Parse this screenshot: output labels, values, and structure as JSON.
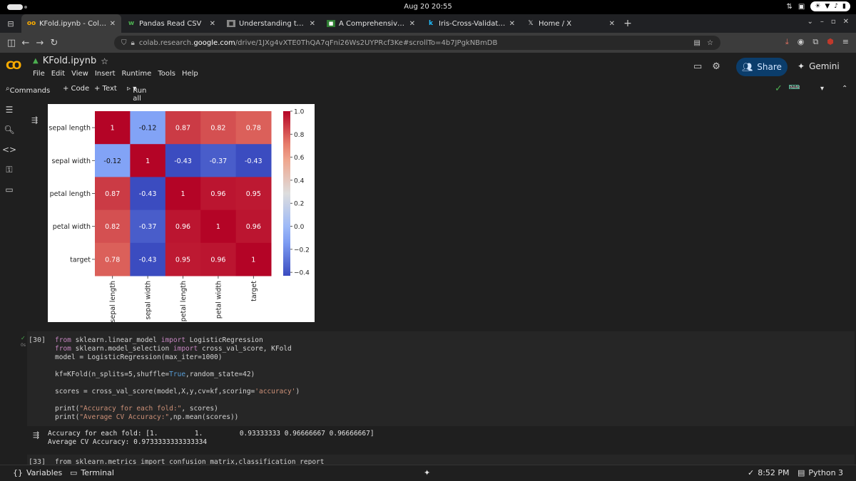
{
  "os": {
    "clock": "Aug 20  20:55"
  },
  "tabs": [
    {
      "title": "KFold.ipynb - Colab",
      "icon": "colab-icon",
      "active": true
    },
    {
      "title": "Pandas Read CSV",
      "icon": "w3schools-icon"
    },
    {
      "title": "Understanding the Confu",
      "icon": "site-icon"
    },
    {
      "title": "A Comprehensive Guide t",
      "icon": "site-icon"
    },
    {
      "title": "Iris-Cross-Validation",
      "icon": "kaggle-icon"
    },
    {
      "title": "Home / X",
      "icon": "x-icon"
    }
  ],
  "address": {
    "prefix": "colab.research.",
    "domain": "google.com",
    "path": "/drive/1JXg4vXTE0ThQA7qFni26Ws2UYPRcf3Ke#scrollTo=4b7JPgkNBmDB"
  },
  "colab": {
    "title": "KFold.ipynb",
    "menu": [
      "File",
      "Edit",
      "View",
      "Insert",
      "Runtime",
      "Tools",
      "Help"
    ],
    "share": "Share",
    "gemini": "Gemini",
    "toolbar": {
      "commands": "Commands",
      "code": "+ Code",
      "text": "+ Text",
      "run_all": "Run all"
    },
    "ram": "RAM",
    "disk": "Disk"
  },
  "chart_data": {
    "type": "heatmap",
    "labels": [
      "sepal length",
      "sepal width",
      "petal length",
      "petal width",
      "target"
    ],
    "matrix": [
      [
        1,
        -0.12,
        0.87,
        0.82,
        0.78
      ],
      [
        -0.12,
        1,
        -0.43,
        -0.37,
        -0.43
      ],
      [
        0.87,
        -0.43,
        1,
        0.96,
        0.95
      ],
      [
        0.82,
        -0.37,
        0.96,
        1,
        0.96
      ],
      [
        0.78,
        -0.43,
        0.95,
        0.96,
        1
      ]
    ],
    "colormap": "coolwarm",
    "vmin": -0.43,
    "vmax": 1.0,
    "colorbar_ticks": [
      "1.0",
      "0.8",
      "0.6",
      "0.4",
      "0.2",
      "0.0",
      "−0.2",
      "−0.4"
    ],
    "colorbar_values": [
      1.0,
      0.8,
      0.6,
      0.4,
      0.2,
      0.0,
      -0.2,
      -0.4
    ]
  },
  "cell": {
    "count": "[30]",
    "time": "0s",
    "lines": [
      [
        [
          "kw",
          "from"
        ],
        [
          "t",
          " sklearn.linear_model "
        ],
        [
          "kw",
          "import"
        ],
        [
          "t",
          " LogisticRegression"
        ]
      ],
      [
        [
          "kw",
          "from"
        ],
        [
          "t",
          " sklearn.model_selection "
        ],
        [
          "kw",
          "import"
        ],
        [
          "t",
          " cross_val_score, KFold"
        ]
      ],
      [
        [
          "t",
          "model = LogisticRegression(max_iter=1000)"
        ]
      ],
      [
        [
          "t",
          ""
        ]
      ],
      [
        [
          "t",
          "kf=KFold(n_splits=5,shuffle="
        ],
        [
          "kb",
          "True"
        ],
        [
          "t",
          ",random_state=42)"
        ]
      ],
      [
        [
          "t",
          ""
        ]
      ],
      [
        [
          "t",
          "scores = cross_val_score(model,X,y,cv=kf,scoring="
        ],
        [
          "str",
          "'accuracy'"
        ],
        [
          "t",
          ")"
        ]
      ],
      [
        [
          "t",
          ""
        ]
      ],
      [
        [
          "t",
          "print("
        ],
        [
          "str",
          "\"Accuracy for each fold:\""
        ],
        [
          "t",
          ", scores)"
        ]
      ],
      [
        [
          "t",
          "print("
        ],
        [
          "str",
          "\"Average CV Accuracy:\""
        ],
        [
          "t",
          ",np.mean(scores))"
        ]
      ]
    ],
    "output": [
      "Accuracy for each fold: [1.         1.         0.93333333 0.96666667 0.96666667]",
      "Average CV Accuracy: 0.9733333333333334"
    ]
  },
  "next_cell": {
    "count": "[33]",
    "code": "from sklearn.metrics import confusion_matrix,classification_report"
  },
  "status": {
    "variables": "Variables",
    "terminal": "Terminal",
    "time": "8:52 PM",
    "runtime": "Python 3"
  }
}
